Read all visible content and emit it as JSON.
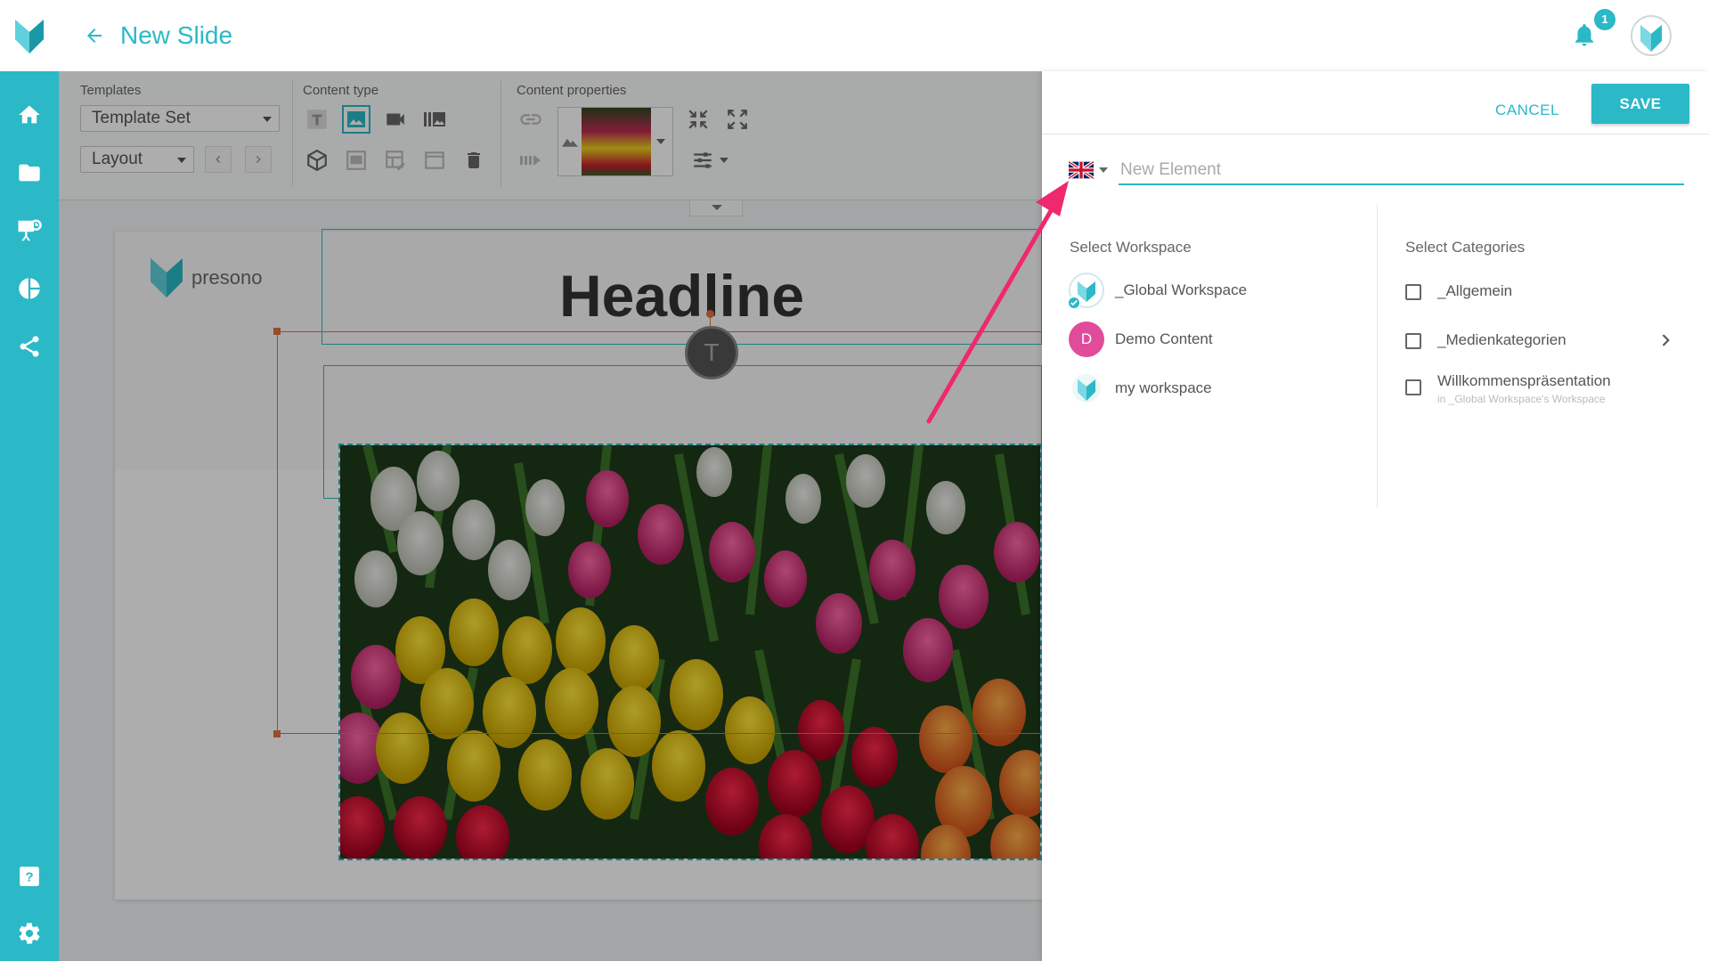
{
  "header": {
    "title": "New Slide",
    "notification_count": "1"
  },
  "sidebar": {
    "items": [
      {
        "icon": "home-icon"
      },
      {
        "icon": "folder-icon"
      },
      {
        "icon": "presentation-icon"
      },
      {
        "icon": "pie-chart-icon"
      },
      {
        "icon": "share-icon"
      }
    ],
    "bottom": [
      {
        "icon": "help-icon"
      },
      {
        "icon": "gear-icon"
      }
    ]
  },
  "toolbar": {
    "templates_label": "Templates",
    "template_set": "Template Set",
    "layout": "Layout",
    "content_type_label": "Content type",
    "content_properties_label": "Content properties"
  },
  "slide": {
    "logo_text": "presono",
    "headline": "Headline",
    "text_button": "T"
  },
  "panel": {
    "cancel": "CANCEL",
    "save": "SAVE",
    "name_placeholder": "New Element",
    "workspace_title": "Select Workspace",
    "categories_title": "Select Categories",
    "workspaces": [
      {
        "label": "_Global Workspace",
        "selected": true
      },
      {
        "label": "Demo Content",
        "initial": "D"
      },
      {
        "label": "my workspace"
      }
    ],
    "categories": [
      {
        "label": "_Allgemein"
      },
      {
        "label": "_Medienkategorien",
        "has_children": true
      },
      {
        "label": "Willkommenspräsentation",
        "sub": "in _Global Workspace's Workspace"
      }
    ]
  },
  "colors": {
    "accent": "#2bb8c7",
    "arrow": "#f0286e",
    "selection": "#e07040"
  }
}
